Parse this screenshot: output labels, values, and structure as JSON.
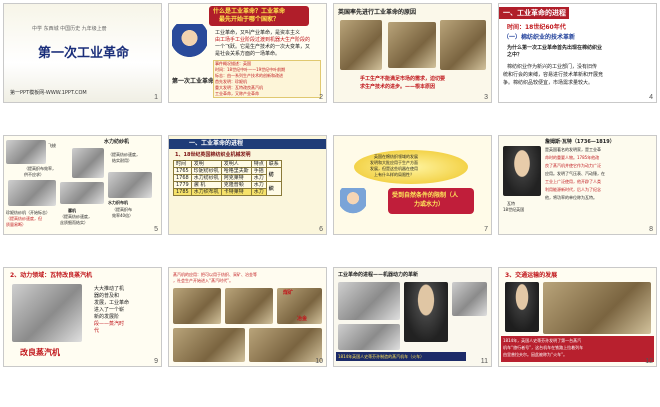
{
  "slides": [
    {
      "num": "1",
      "top": "中学 东西城    中国历史    九年级上册",
      "title": "第一次工业革命",
      "foot": "第一PPT模板网-WWW.1PPT.COM"
    },
    {
      "num": "2",
      "q1": "什么是工业革命？工业革命",
      "q2": "最先开始于哪个国家？",
      "body1": "工业革命，又叫产业革命，是资本主义",
      "body2": "由工场手工业阶段过渡到机器大生产阶段的",
      "body3": "一个飞跃。它是生产技术的一次大变革，又",
      "body4": "是社会关系方面的一场革命。",
      "label": "第一次工业革命",
      "info1": "事件概况描述：英国",
      "info2": "时间：18世纪中叶——19世纪中叶前期",
      "info3": "标志：由一系列生产技术的创新和改进",
      "info4": "首先发明：珍妮机",
      "info5": "重大发明：瓦特改良蒸汽机",
      "info6": "工业革命，又称产业革命"
    },
    {
      "num": "3",
      "title": "英国率先进行工业革命的原因",
      "quote1": "手工生产不能满足市场的需求，迫切要",
      "quote2": "求生产技术的进步。——根本原因"
    },
    {
      "num": "4",
      "heading": "一、工业革命的进程",
      "time": "时间：18世纪60年代",
      "sub": "（一）棉纺织业的技术革新",
      "q": "为什么第一次工业革命首先出现在棉纺织业",
      "q2": "之中？",
      "a1": "棉纺织业作为新兴的工业部门，没有旧传",
      "a2": "统和行会的束缚，容易进行技术革新和开展竞",
      "a3": "争。棉纺织品较便宜，市场需求量较大。"
    },
    {
      "num": "5",
      "label": "水力纺纱机",
      "note1": "（提高纺纱速度，",
      "note2": "结实耐用）",
      "fly": "飞梭",
      "fly2": "（提高织布效率，",
      "fly3": "供不应求）",
      "jenny": "珍妮纺纱机（开始标志）",
      "jenny2": "（提高纺纱速度，但",
      "jenny3": "质量易断）",
      "mule": "骡机",
      "mule2": "（提高纺纱速度，",
      "mule3": "丝质细而结实）",
      "loom": "水力织布机",
      "loom2": "（提高织布",
      "loom3": "效率40倍）"
    },
    {
      "num": "6",
      "heading": "一、工业革命的进程",
      "sub": "1、18世纪英国棉纺织业机械发明",
      "h1": "时间",
      "h2": "发明",
      "h3": "发明人",
      "h4": "特点",
      "h5": "联系",
      "r1a": "1765",
      "r1b": "珍妮纺纱机",
      "r1c": "哈格里夫斯",
      "r1d": "手摇",
      "r2a": "1768",
      "r2b": "水力纺纱机",
      "r2c": "阿克莱特",
      "r2d": "水力",
      "r3a": "1779",
      "r3b": "骡  机",
      "r3c": "克隆普顿",
      "r3d": "水力",
      "r4a": "1785",
      "r4b": "水力织布机",
      "r4c": "卡特莱特",
      "r4d": "水力",
      "l1": "纺",
      "l2": "织"
    },
    {
      "num": "7",
      "t1": "英国在棉纺织领域的发展",
      "t2": "发明和大批应用于生产方面",
      "t3": "发展，但是这些机器在使用",
      "t4": "上有什么样的局限性？",
      "ans1": "受到自然条件的限制（人",
      "ans2": "力或水力）"
    },
    {
      "num": "8",
      "name": "詹姆斯·瓦特（1736—1819）",
      "a1": "是英国著名的发明家，是工业革",
      "a2": "命时的重要人物。1785年他改",
      "a3": "良了蒸汽机并使它作为动力广泛",
      "a4": "应用。发明了气压表、汽动锤，在",
      "a5": "工业上广泛使用，他开辟了人类",
      "a6": "利用能源新时代，后人为了纪念",
      "a7": "他，将功率的单位称为瓦特。",
      "cap": "瓦特",
      "cap2": "18世纪英国"
    },
    {
      "num": "9",
      "heading": "2、动力领域：瓦特改良蒸汽机",
      "b1": "大大推动了机",
      "b2": "器的普及和",
      "b3": "发展，工业革命",
      "b4": "进入了一个崭",
      "b5": "新的发展阶",
      "b6": "段——蒸汽时",
      "b7": "代",
      "label": "改良蒸汽机"
    },
    {
      "num": "10",
      "t1": "蒸汽机的应用：把可以用于纺织、采矿、冶金等",
      "t2": "，社会生产开始进入“蒸汽时代”。",
      "l1": "煤矿",
      "l2": "冶金"
    },
    {
      "num": "11",
      "title": "工业革命的进程——机器动力的革新",
      "cap": "1814年英国人史蒂芬孙制造的蒸汽机车（火车）"
    },
    {
      "num": "12",
      "heading": "3、交通运输的发展",
      "c1": "1814年，英国人史蒂芬孙发明了第一台蒸汽",
      "c2": "机车“旅行者号”，这台机车在铁路上拉着列车",
      "c3": "由里普拉夫尔。因此被称为“火车”。"
    }
  ]
}
